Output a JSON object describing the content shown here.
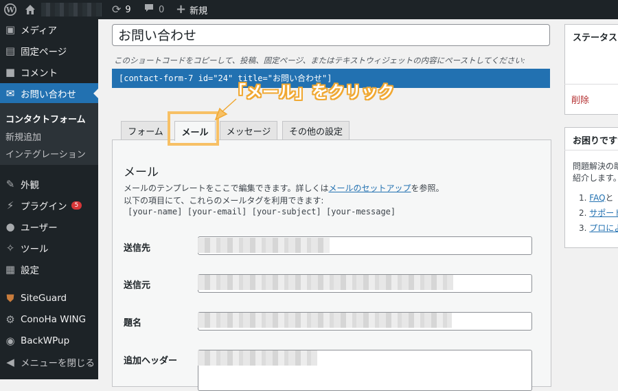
{
  "admin_bar": {
    "updates_count": "9",
    "comments_count": "0",
    "new_label": "新規"
  },
  "sidebar": {
    "items": [
      {
        "label": "メディア",
        "icon": "media-icon"
      },
      {
        "label": "固定ページ",
        "icon": "page-icon"
      },
      {
        "label": "コメント",
        "icon": "comment-icon"
      },
      {
        "label": "お問い合わせ",
        "icon": "mail-icon"
      },
      {
        "label": "外観",
        "icon": "appearance-icon"
      },
      {
        "label": "プラグイン",
        "icon": "plugin-icon",
        "badge": "5"
      },
      {
        "label": "ユーザー",
        "icon": "user-icon"
      },
      {
        "label": "ツール",
        "icon": "tool-icon"
      },
      {
        "label": "設定",
        "icon": "settings-icon"
      },
      {
        "label": "SiteGuard",
        "icon": "shield-icon"
      },
      {
        "label": "ConoHa WING",
        "icon": "gear-icon"
      },
      {
        "label": "BackWPup",
        "icon": "backup-icon"
      },
      {
        "label": "メニューを閉じる",
        "icon": "collapse-icon"
      }
    ],
    "submenu": [
      "コンタクトフォーム",
      "新規追加",
      "インテグレーション"
    ]
  },
  "form": {
    "title": "お問い合わせ",
    "shortcode_hint": "このショートコードをコピーして、投稿、固定ページ、またはテキストウィジェットの内容にペーストしてください:",
    "shortcode": "[contact-form-7 id=\"24\" title=\"お問い合わせ\"]"
  },
  "annotation": {
    "text": "「メール」をクリック",
    "color": "#f0a832"
  },
  "tabs": [
    "フォーム",
    "メール",
    "メッセージ",
    "その他の設定"
  ],
  "mail_panel": {
    "title": "メール",
    "desc_line1_prefix": "メールのテンプレートをここで編集できます。詳しくは",
    "desc_link": "メールのセットアップ",
    "desc_line1_suffix": "を参照。",
    "desc_line2": "以下の項目にて、これらのメールタグを利用できます:",
    "mail_tags": "[your-name] [your-email] [your-subject] [your-message]",
    "fields": [
      "送信先",
      "送信元",
      "題名",
      "追加ヘッダー"
    ]
  },
  "status_box": {
    "title": "ステータス",
    "delete_label": "削除"
  },
  "help_box": {
    "title": "お困りですか",
    "text_line1": "問題解決の助",
    "text_line2": "紹介します。",
    "links": [
      {
        "num": "1.",
        "text": "FAQ",
        "extra": "と"
      },
      {
        "num": "2.",
        "text": "サポート"
      },
      {
        "num": "3.",
        "text": "プロによ"
      }
    ]
  },
  "colors": {
    "admin_dark": "#1d2327",
    "accent_blue": "#2271b1",
    "highlight_orange": "#f7c065",
    "delete_red": "#b32d2e"
  }
}
